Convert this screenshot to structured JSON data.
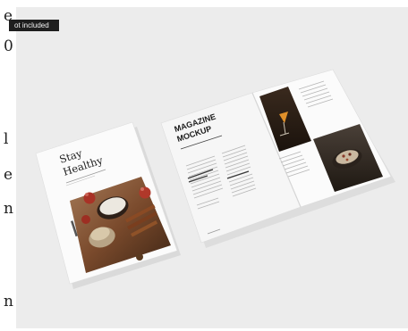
{
  "badge": {
    "text": "ot included"
  },
  "left_edge_letters": [
    "e",
    "0",
    "l",
    "e",
    "n",
    "n"
  ],
  "magazine_cover": {
    "title_line_1": "Stay",
    "title_line_2": "Healthy"
  },
  "magazine_spread": {
    "heading_line_1": "MAGAZINE",
    "heading_line_2": "MOCKUP"
  },
  "colors": {
    "background": "#ececec",
    "paper": "#fbfbfb",
    "badge": "#1e1e1e",
    "wood": "#7a4a2c",
    "cinnamon": "#8a4a24",
    "drink": "#e0902a"
  }
}
